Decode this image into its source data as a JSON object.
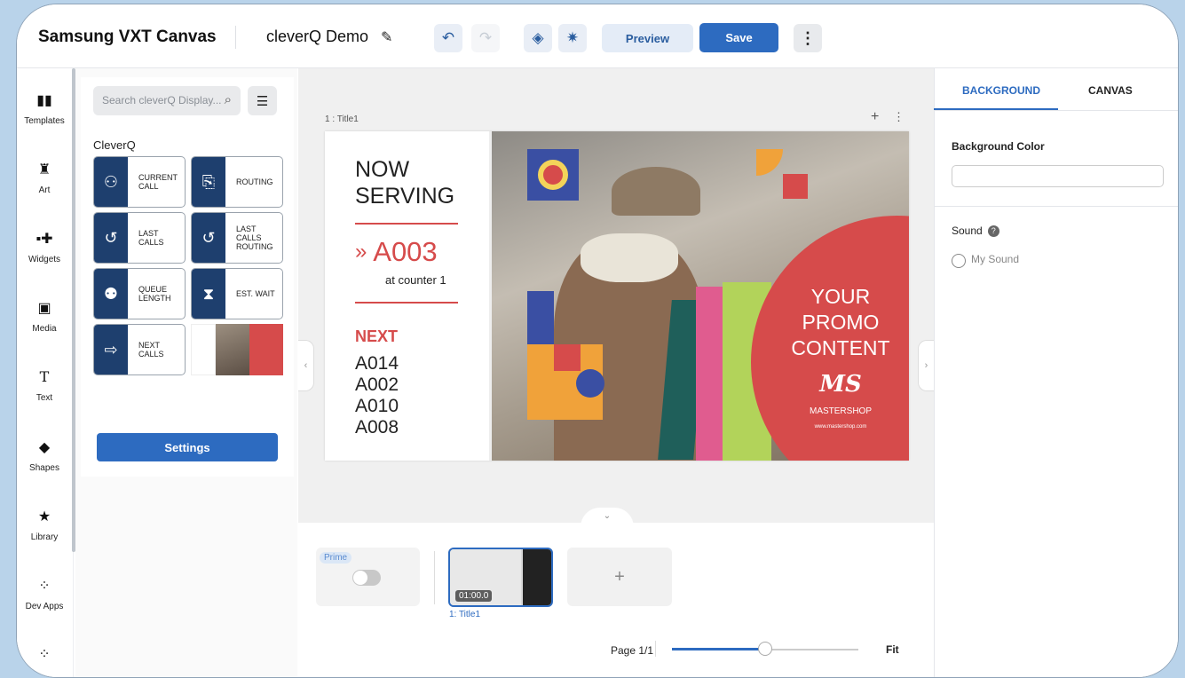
{
  "header": {
    "brand": "Samsung VXT Canvas",
    "project_name": "cleverQ Demo",
    "preview_label": "Preview",
    "save_label": "Save"
  },
  "rail": {
    "items": [
      {
        "label": "Templates",
        "icon": "templates-icon"
      },
      {
        "label": "Art",
        "icon": "art-icon"
      },
      {
        "label": "Widgets",
        "icon": "widgets-icon"
      },
      {
        "label": "Media",
        "icon": "media-icon"
      },
      {
        "label": "Text",
        "icon": "text-icon"
      },
      {
        "label": "Shapes",
        "icon": "shapes-icon"
      },
      {
        "label": "Library",
        "icon": "star-icon"
      },
      {
        "label": "Dev Apps",
        "icon": "dev-apps-icon"
      }
    ]
  },
  "left_panel": {
    "search_placeholder": "Search cleverQ Display...",
    "section_title": "CleverQ",
    "tiles": [
      {
        "label": "CURRENT CALL"
      },
      {
        "label": "ROUTING"
      },
      {
        "label": "LAST CALLS"
      },
      {
        "label": "LAST CALLS ROUTING"
      },
      {
        "label": "QUEUE LENGTH"
      },
      {
        "label": "EST. WAIT"
      },
      {
        "label": "NEXT CALLS"
      }
    ],
    "settings_label": "Settings"
  },
  "canvas": {
    "slide_label": "1 : Title1",
    "slide": {
      "now_serving_line1": "NOW",
      "now_serving_line2": "SERVING",
      "current_number": "A003",
      "counter_text": "at counter 1",
      "next_label": "NEXT",
      "next_numbers": [
        "A014",
        "A002",
        "A010",
        "A008"
      ],
      "promo_line1": "YOUR",
      "promo_line2": "PROMO",
      "promo_line3": "CONTENT",
      "logo_mark": "MS",
      "brand_name": "MASTERSHOP",
      "brand_url": "www.mastershop.com"
    }
  },
  "bottom": {
    "prime_badge": "Prime",
    "thumb_duration": "01:00.0",
    "thumb_label": "1: Title1",
    "add_label": "+",
    "page_info": "Page 1/1",
    "zoom_level": 0.5,
    "fit_label": "Fit"
  },
  "right_panel": {
    "tabs": [
      "BACKGROUND",
      "CANVAS"
    ],
    "active_tab": "BACKGROUND",
    "bg_color_label": "Background Color",
    "sound_label": "Sound",
    "sound_option": "My Sound"
  },
  "colors": {
    "primary": "#2d6bc0",
    "navy_tile": "#1e3f6e",
    "promo_red": "#d64b4b"
  }
}
